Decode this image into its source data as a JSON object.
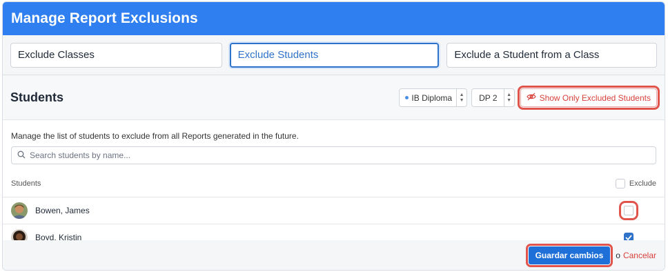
{
  "header": {
    "title": "Manage Report Exclusions"
  },
  "tabs": [
    {
      "label": "Exclude Classes",
      "active": false
    },
    {
      "label": "Exclude Students",
      "active": true
    },
    {
      "label": "Exclude a Student from a Class",
      "active": false
    }
  ],
  "section": {
    "title": "Students",
    "program_select": {
      "value": "IB Diploma"
    },
    "grade_select": {
      "value": "DP 2"
    },
    "filter_button_label": "Show Only Excluded Students"
  },
  "description": "Manage the list of students to exclude from all Reports generated in the future.",
  "search": {
    "placeholder": "Search students by name..."
  },
  "table": {
    "col_students": "Students",
    "col_exclude": "Exclude",
    "rows": [
      {
        "name": "Bowen, James",
        "excluded": false
      },
      {
        "name": "Boyd, Kristin",
        "excluded": true
      }
    ]
  },
  "footer": {
    "save_label": "Guardar cambios",
    "or_text": "o",
    "cancel_label": "Cancelar"
  },
  "colors": {
    "header_bg": "#2f7ff0",
    "accent_blue": "#2f72c9",
    "danger_red": "#d9403a",
    "highlight_red": "#e0544c"
  }
}
